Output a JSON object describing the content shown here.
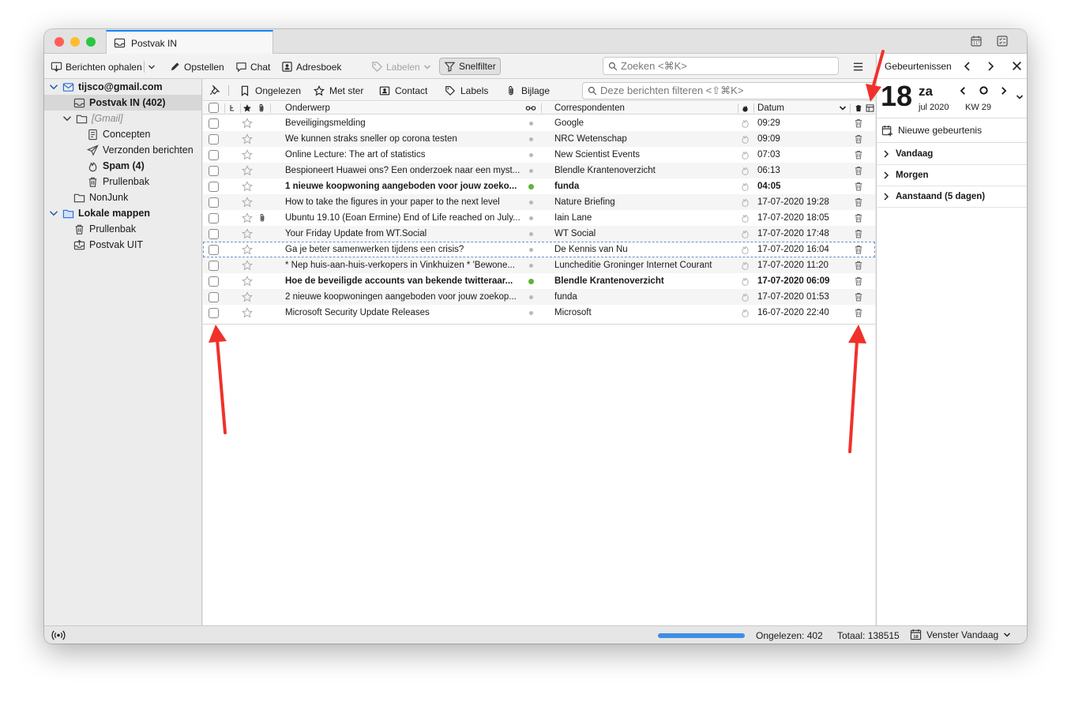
{
  "window": {
    "tab_title": "Postvak IN"
  },
  "toolbar": {
    "get_messages": "Berichten ophalen",
    "compose": "Opstellen",
    "chat": "Chat",
    "address_book": "Adresboek",
    "tag": "Labelen",
    "quick_filter": "Snelfilter",
    "search_placeholder": "Zoeken <⌘K>"
  },
  "sidebar": {
    "account": "tijsco@gmail.com",
    "inbox": "Postvak IN (402)",
    "gmail": "[Gmail]",
    "drafts": "Concepten",
    "sent": "Verzonden berichten",
    "spam": "Spam (4)",
    "trash": "Prullenbak",
    "nonjunk": "NonJunk",
    "local": "Lokale mappen",
    "local_trash": "Prullenbak",
    "outbox": "Postvak UIT"
  },
  "quickfilter": {
    "unread": "Ongelezen",
    "starred": "Met ster",
    "contact": "Contact",
    "labels": "Labels",
    "attachment": "Bijlage",
    "filter_placeholder": "Deze berichten filteren <⇧⌘K>"
  },
  "columns": {
    "subject": "Onderwerp",
    "correspondents": "Correspondenten",
    "date": "Datum"
  },
  "messages": [
    {
      "subject": "Beveiligingsmelding",
      "from": "Google",
      "date": "09:29"
    },
    {
      "subject": "We kunnen straks sneller op corona testen",
      "from": "NRC Wetenschap",
      "date": "09:09"
    },
    {
      "subject": "Online Lecture: The art of statistics",
      "from": "New Scientist Events",
      "date": "07:03"
    },
    {
      "subject": "Bespioneert Huawei ons? Een onderzoek naar een myst...",
      "from": "Blendle Krantenoverzicht",
      "date": "06:13"
    },
    {
      "subject": "1 nieuwe koopwoning aangeboden voor jouw zoeko...",
      "from": "funda",
      "date": "04:05"
    },
    {
      "subject": "How to take the figures in your paper to the next level",
      "from": "Nature Briefing",
      "date": "17-07-2020 19:28"
    },
    {
      "subject": "Ubuntu 19.10 (Eoan Ermine) End of Life reached on July...",
      "from": "Iain Lane",
      "date": "17-07-2020 18:05"
    },
    {
      "subject": "Your Friday Update from WT.Social",
      "from": "WT Social",
      "date": "17-07-2020 17:48"
    },
    {
      "subject": "Ga je beter samenwerken tijdens een crisis?",
      "from": "De Kennis van Nu",
      "date": "17-07-2020 16:04"
    },
    {
      "subject": "* Nep huis-aan-huis-verkopers in Vinkhuizen * 'Bewone...",
      "from": "Luncheditie Groninger Internet Courant",
      "date": "17-07-2020 11:20"
    },
    {
      "subject": "Hoe de beveiligde accounts van bekende twitteraar...",
      "from": "Blendle Krantenoverzicht",
      "date": "17-07-2020 06:09"
    },
    {
      "subject": "2 nieuwe koopwoningen aangeboden voor jouw zoekop...",
      "from": "funda",
      "date": "17-07-2020 01:53"
    },
    {
      "subject": "Microsoft Security Update Releases",
      "from": "Microsoft",
      "date": "16-07-2020 22:40"
    }
  ],
  "today_pane": {
    "title": "Gebeurtenissen",
    "day": "18",
    "weekday": "za",
    "month_year": "jul 2020",
    "week": "KW 29",
    "new_event": "Nieuwe gebeurtenis",
    "today": "Vandaag",
    "tomorrow": "Morgen",
    "upcoming": "Aanstaand (5 dagen)"
  },
  "status": {
    "unread": "Ongelezen: 402",
    "total": "Totaal: 138515",
    "today_pane": "Venster Vandaag"
  },
  "colors": {
    "accent": "#0a84ff",
    "annotation_arrow": "#f0312b",
    "unread_dot": "#5fb336"
  }
}
